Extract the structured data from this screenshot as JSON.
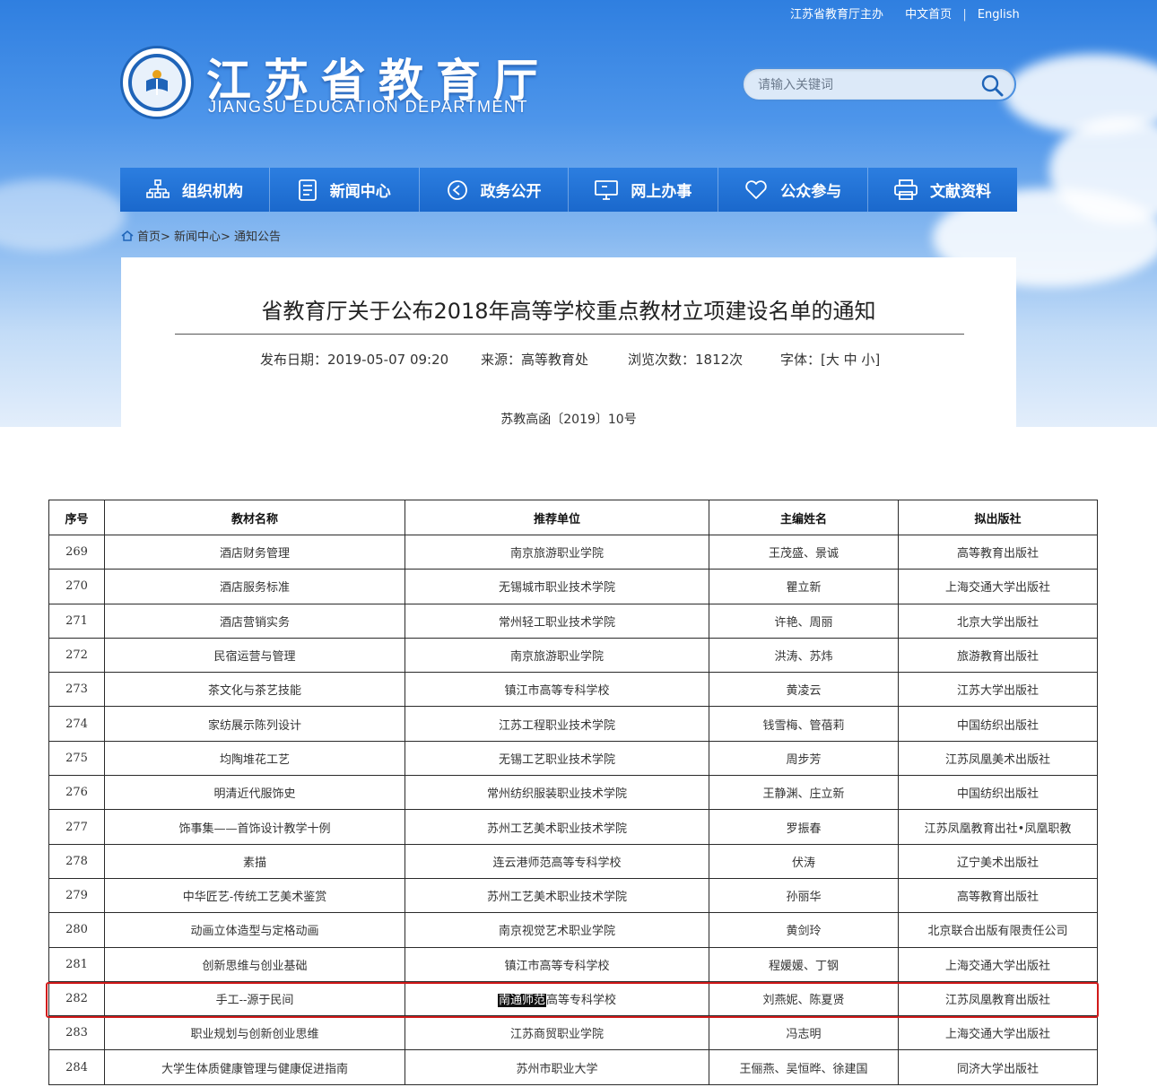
{
  "header": {
    "host_text": "江苏省教育厅主办",
    "home_cn": "中文首页",
    "separator": "|",
    "english": "English",
    "logo_title": "江苏省教育厅",
    "logo_subtitle": "JIANGSU EDUCATION DEPARTMENT",
    "search_placeholder": "请输入关键词"
  },
  "nav": {
    "items": [
      {
        "label": "组织机构",
        "icon": "org-chart-icon"
      },
      {
        "label": "新闻中心",
        "icon": "document-icon"
      },
      {
        "label": "政务公开",
        "icon": "play-circle-icon"
      },
      {
        "label": "网上办事",
        "icon": "monitor-icon"
      },
      {
        "label": "公众参与",
        "icon": "heart-icon"
      },
      {
        "label": "文献资料",
        "icon": "printer-icon"
      }
    ]
  },
  "breadcrumb": "首页> 新闻中心> 通知公告",
  "article": {
    "title": "省教育厅关于公布2018年高等学校重点教材立项建设名单的通知",
    "publish_date": "发布日期：2019-05-07 09:20",
    "source": "来源：高等教育处",
    "views": "浏览次数：1812次",
    "font_size": "字体：[大 中 小]",
    "doc_number": "苏教高函〔2019〕10号"
  },
  "table": {
    "headers": [
      "序号",
      "教材名称",
      "推荐单位",
      "主编姓名",
      "拟出版社"
    ],
    "rows": [
      [
        "269",
        "酒店财务管理",
        "南京旅游职业学院",
        "王茂盛、景诚",
        "高等教育出版社"
      ],
      [
        "270",
        "酒店服务标准",
        "无锡城市职业技术学院",
        "瞿立新",
        "上海交通大学出版社"
      ],
      [
        "271",
        "酒店营销实务",
        "常州轻工职业技术学院",
        "许艳、周丽",
        "北京大学出版社"
      ],
      [
        "272",
        "民宿运营与管理",
        "南京旅游职业学院",
        "洪涛、苏炜",
        "旅游教育出版社"
      ],
      [
        "273",
        "茶文化与茶艺技能",
        "镇江市高等专科学校",
        "黄凌云",
        "江苏大学出版社"
      ],
      [
        "274",
        "家纺展示陈列设计",
        "江苏工程职业技术学院",
        "钱雪梅、管蓓莉",
        "中国纺织出版社"
      ],
      [
        "275",
        "均陶堆花工艺",
        "无锡工艺职业技术学院",
        "周步芳",
        "江苏凤凰美术出版社"
      ],
      [
        "276",
        "明清近代服饰史",
        "常州纺织服装职业技术学院",
        "王静渊、庄立新",
        "中国纺织出版社"
      ],
      [
        "277",
        "饰事集——首饰设计教学十例",
        "苏州工艺美术职业技术学院",
        "罗振春",
        "江苏凤凰教育出社•凤凰职教"
      ],
      [
        "278",
        "素描",
        "连云港师范高等专科学校",
        "伏涛",
        "辽宁美术出版社"
      ],
      [
        "279",
        "中华匠艺-传统工艺美术鉴赏",
        "苏州工艺美术职业技术学院",
        "孙丽华",
        "高等教育出版社"
      ],
      [
        "280",
        "动画立体造型与定格动画",
        "南京视觉艺术职业学院",
        "黄剑玲",
        "北京联合出版有限责任公司"
      ],
      [
        "281",
        "创新思维与创业基础",
        "镇江市高等专科学校",
        "程媛媛、丁钢",
        "上海交通大学出版社"
      ],
      [
        "282",
        "手工--源于民间",
        "南通师范高等专科学校",
        "刘燕妮、陈夏贤",
        "江苏凤凰教育出版社"
      ],
      [
        "283",
        "职业规划与创新创业思维",
        "江苏商贸职业学院",
        "冯志明",
        "上海交通大学出版社"
      ],
      [
        "284",
        "大学生体质健康管理与健康促进指南",
        "苏州市职业大学",
        "王俪燕、吴恒晔、徐建国",
        "同济大学出版社"
      ]
    ],
    "highlight_row": "282",
    "highlight_text": "南通师范",
    "highlight_rest": "高等专科学校"
  },
  "colors": {
    "nav_blue": "#1a68cc",
    "highlight_border": "#d11a1a"
  }
}
